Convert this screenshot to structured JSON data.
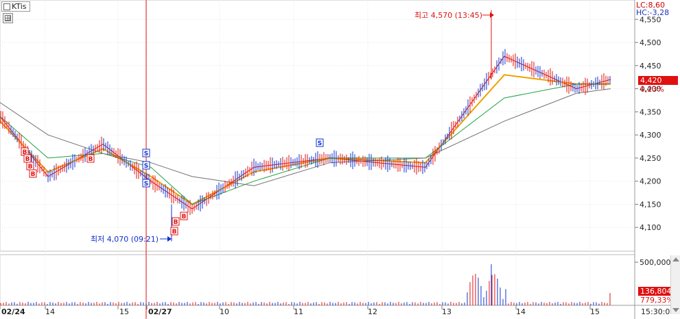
{
  "ticker": "KTis",
  "header": {
    "lc": "LC:8,60",
    "hc": "HC:-3,28"
  },
  "price_axis": [
    "4,550",
    "4,500",
    "4,450",
    "4,400",
    "4,350",
    "4,300",
    "4,250",
    "4,200",
    "4,150",
    "4,100"
  ],
  "volume_axis": [
    "500,000"
  ],
  "current": {
    "price": "4,420",
    "pct": "0,23%",
    "volume": "136,804",
    "volume_pct": "779,33%"
  },
  "annotations": {
    "high": "최고 4,570 (13:45)",
    "low": "최저 4,070 (09:21)"
  },
  "x_labels": [
    "02/24",
    "14",
    "15",
    "02/27",
    "10",
    "11",
    "12",
    "13",
    "14",
    "15",
    "15:30:00"
  ],
  "signals": {
    "buy": "B",
    "sell": "S"
  },
  "colors": {
    "up": "#e01010",
    "down": "#1030d0",
    "ma_short": "#f0a000",
    "ma_mid": "#20a040",
    "ma_long": "#707070",
    "bg": "#ffffff"
  },
  "chart_data": {
    "type": "line",
    "title": "",
    "ylim": [
      4050,
      4580
    ],
    "y_ticks": [
      4100,
      4150,
      4200,
      4250,
      4300,
      4350,
      4400,
      4450,
      4500,
      4550
    ],
    "x": [
      "02/24",
      "14",
      "15",
      "02/27",
      "10",
      "11",
      "12",
      "13",
      "14",
      "15"
    ],
    "series": [
      {
        "values": [
          4340,
          4210,
          4280,
          4200,
          4140,
          4230,
          4250,
          4230,
          4470,
          4400,
          4420
        ]
      },
      {
        "values": [
          4330,
          4220,
          4270,
          4210,
          4150,
          4220,
          4250,
          4240,
          4430,
          4410,
          4410
        ]
      },
      {
        "values": [
          4340,
          4250,
          4260,
          4230,
          4150,
          4200,
          4250,
          4250,
          4380,
          4410,
          4410
        ]
      },
      {
        "values": [
          4370,
          4300,
          4260,
          4240,
          4210,
          4190,
          4240,
          4250,
          4330,
          4390,
          4400
        ]
      }
    ],
    "high": 4570,
    "low": 4070,
    "volume_max_label": 500000
  }
}
